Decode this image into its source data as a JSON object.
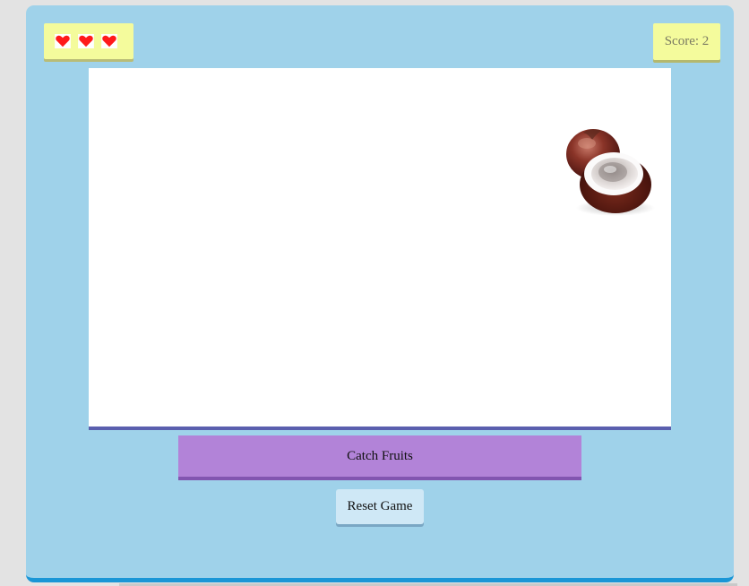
{
  "hud": {
    "lives": 3,
    "lives_icon": "heart-icon",
    "score_text": "Score: 2"
  },
  "play_area": {
    "fruit_icon": "mangosteen-fruit-icon"
  },
  "controls": {
    "catch_label": "Catch Fruits",
    "reset_label": "Reset Game"
  },
  "colors": {
    "panel": "#9fd2ea",
    "panel_border": "#1a96d6",
    "hud_box": "#f4fb9c",
    "catch_button": "#b283d8",
    "reset_button": "#cfe8f6",
    "heart": "#ff1a1a"
  }
}
